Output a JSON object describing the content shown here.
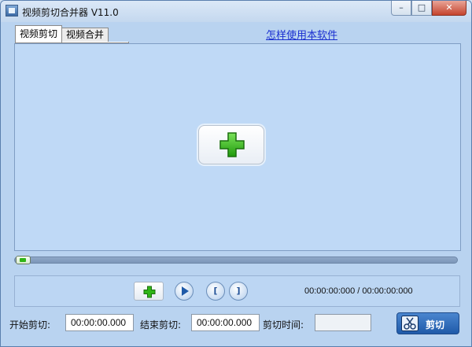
{
  "window": {
    "title": "视频剪切合并器 V11.0",
    "min_glyph": "–",
    "max_glyph": "□",
    "close_glyph": "✕"
  },
  "tabs": [
    {
      "label": "视频剪切",
      "active": true
    },
    {
      "label": "视频合并",
      "active": false
    }
  ],
  "help_link": "怎样使用本软件",
  "player": {
    "progress": 0.0,
    "time_readout": "00:00:00:000 / 00:00:00:000"
  },
  "controls": {
    "add_icon": "plus-icon",
    "play_icon": "play-icon",
    "mark_in_glyph": "[",
    "mark_out_glyph": "]"
  },
  "cut": {
    "start_label": "开始剪切:",
    "start_value": "00:00:00.000",
    "end_label": "结束剪切:",
    "end_value": "00:00:00.000",
    "duration_label": "剪切时间:",
    "duration_value": "",
    "cut_button_label": "剪切"
  },
  "colors": {
    "accent_green": "#2fb516",
    "link_blue": "#1a2fd0",
    "cut_button_blue": "#1f5aa9"
  }
}
